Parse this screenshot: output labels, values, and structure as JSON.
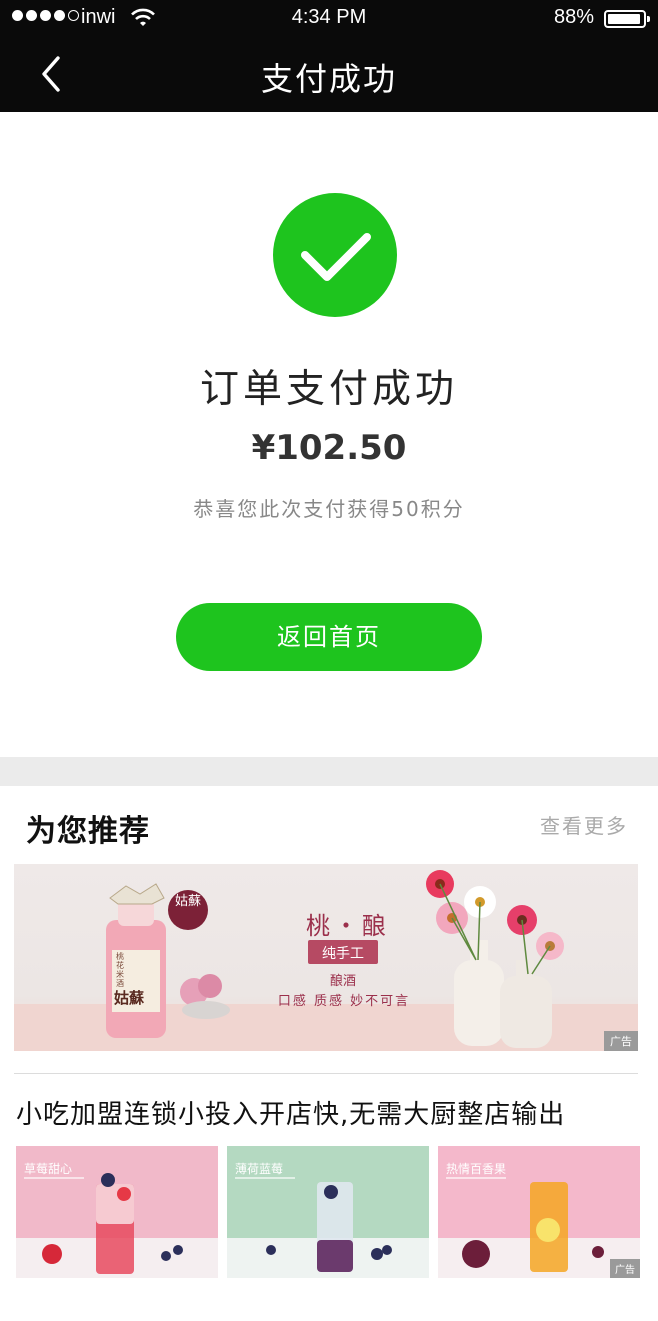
{
  "status_bar": {
    "carrier": "inwi",
    "time": "4:34 PM",
    "battery_percent": "88%"
  },
  "nav": {
    "title": "支付成功"
  },
  "result": {
    "title": "订单支付成功",
    "amount": "¥102.50",
    "points_note": "恭喜您此次支付获得50积分",
    "home_button_label": "返回首页"
  },
  "recommend": {
    "title": "为您推荐",
    "more_label": "查看更多",
    "banner": {
      "brand": "姑蘇",
      "bottle_label": "桃花米酒",
      "bottle_brand": "姑蘇",
      "headline": "桃・酿",
      "badge": "纯手工",
      "sub": "酿酒",
      "tagline": "口感 质感 妙不可言",
      "ad_tag": "广告"
    },
    "article": {
      "title": "小吃加盟连锁小投入开店快,无需大厨整店输出",
      "thumbnails": [
        {
          "label": "草莓甜心",
          "color": "#f1b9c9"
        },
        {
          "label": "薄荷蓝莓",
          "color": "#b4d9c1"
        },
        {
          "label": "热情百香果",
          "color": "#f4b8cb"
        }
      ],
      "ad_tag": "广告"
    }
  },
  "colors": {
    "accent_green": "#1ec41e",
    "nav_background": "#0a0a0a"
  }
}
